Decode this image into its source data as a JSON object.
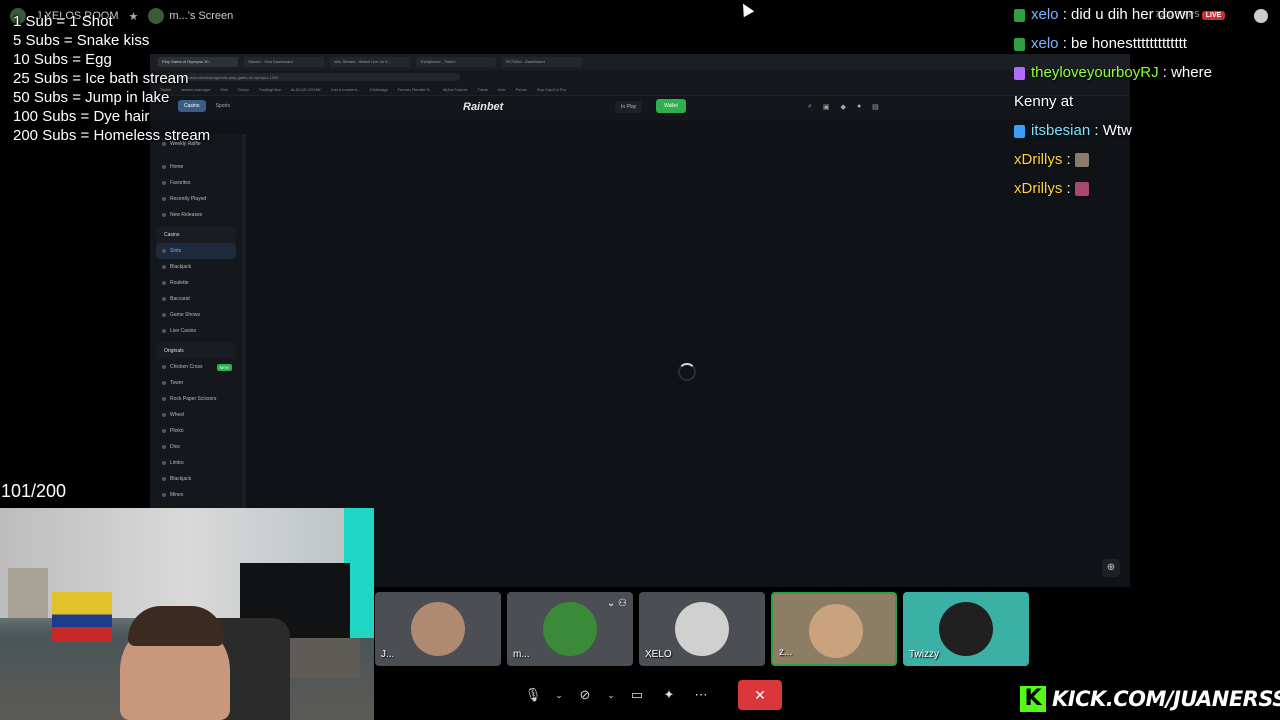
{
  "topbar": {
    "server": "J XELOS ROOM",
    "screen_label": "m...'s Screen"
  },
  "subs_goals": [
    "1 Sub = 1 Shot",
    "5 Subs = Snake kiss",
    "10 Subs = Egg",
    "25 Subs = Ice bath stream",
    "50 Subs = Jump in lake",
    "100 Subs = Dye hair",
    "200 Subs = Homeless stream"
  ],
  "subs_count": "101/200",
  "browser": {
    "tabs": [
      "Play Gates of Olympus 10...",
      "Stream - Kick Dashboard",
      "xelo Stream - Watch Live on K...",
      "Thellybrave - Twitch",
      "RCTsKid - Dashboard"
    ],
    "url": "rainbet.com/casino/slots/pragmatic-play-gates-of-olympus-1000",
    "bookmarks": [
      "Twitch",
      "stream manager",
      "Kick",
      "Dump",
      "TradingView",
      "ALDCAD GSHW",
      "Just a moment...",
      "Kickbrags",
      "Formex Render N...",
      "Alpha Futures",
      "Trade",
      "Kick",
      "Perms",
      "Buy CapCut Pro"
    ]
  },
  "site": {
    "logo": "Rainbet",
    "casino_tab": "Casino",
    "sports_tab": "Sports",
    "inplay": "In Play",
    "wallet": "Wallet",
    "sidebar": {
      "top_items": [
        "Weekly Raffle",
        "Home",
        "Favorites",
        "Recently Played",
        "New Releases"
      ],
      "casino_group": "Casino",
      "casino_items": [
        "Slots",
        "Blackjack",
        "Roulette",
        "Baccarat",
        "Game Shows",
        "Live Casino"
      ],
      "originals_group": "Originals",
      "originals_items": [
        "Chicken Cross",
        "Tower",
        "Rock Paper Scissors",
        "Wheel",
        "Plinko",
        "Dice",
        "Limbo",
        "Blackjack",
        "Mines"
      ],
      "new_badge": "NEW"
    }
  },
  "chat": [
    {
      "user": "xelo",
      "text": "did u dih her down",
      "color": "#7fb3ff",
      "badge": "#2ea043"
    },
    {
      "user": "xelo",
      "text": "be honesttttttttttttt",
      "color": "#7fb3ff",
      "badge": "#2ea043"
    },
    {
      "user": "theyloveyourboyRJ",
      "text": "where",
      "color": "#8cff3a",
      "badge": "#b36bff"
    },
    {
      "user": "",
      "text": "Kenny at",
      "color": "#ffffff",
      "badge": ""
    },
    {
      "user": "itsbesian",
      "text": "Wtw",
      "color": "#7fe0ff",
      "badge": "#3aa0ff"
    },
    {
      "user": "xDrillys",
      "text": "",
      "color": "#ffd23a",
      "badge": ""
    },
    {
      "user": "xDrillys",
      "text": "",
      "color": "#ffd23a",
      "badge": ""
    }
  ],
  "live_info": {
    "quality": "720p 30FPS",
    "live": "LIVE"
  },
  "participants": [
    {
      "name": "J...",
      "color": "#b08a70"
    },
    {
      "name": "m...",
      "color": "#3b8a3a"
    },
    {
      "name": "XELO",
      "color": "#d0d0d0"
    },
    {
      "name": "z...",
      "color": "#c9a27e"
    },
    {
      "name": "Twizzy",
      "color": "#202020"
    }
  ],
  "kick_url": "KICK.COM/JUANERSSS",
  "icons": {
    "mic": "microphone-icon",
    "camera_off": "camera-off-icon",
    "screen_share": "screen-share-icon",
    "activities": "activities-icon",
    "more": "more-icon",
    "hangup": "hangup-icon"
  }
}
